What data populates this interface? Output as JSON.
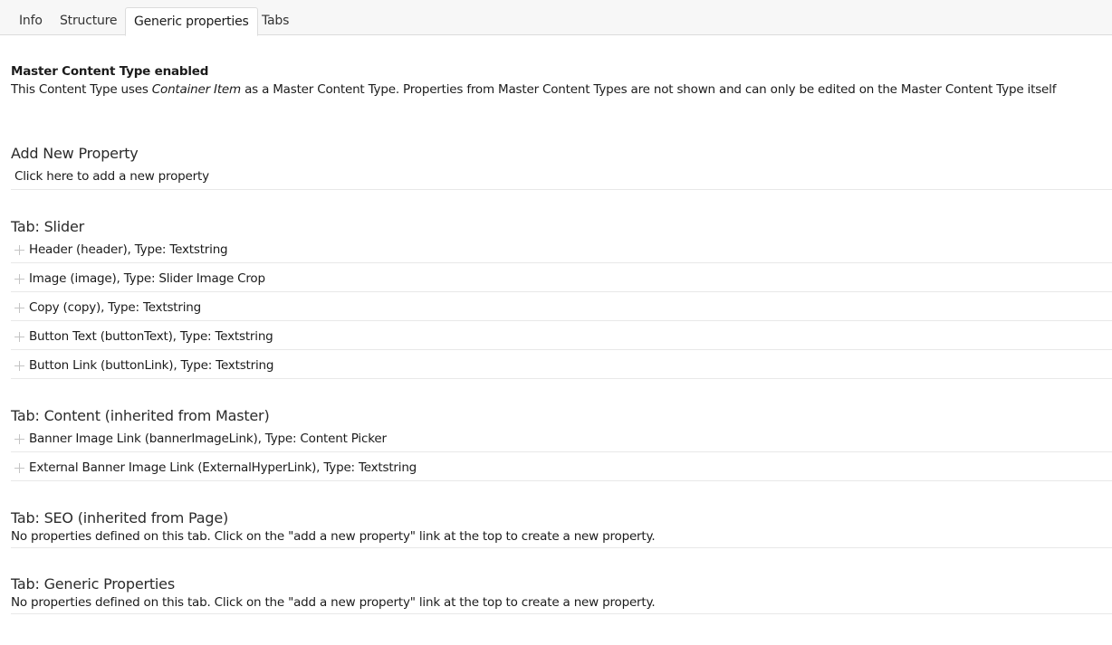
{
  "tabs": [
    {
      "label": "Info",
      "active": false
    },
    {
      "label": "Structure",
      "active": false
    },
    {
      "label": "Generic properties",
      "active": true
    },
    {
      "label": "Tabs",
      "active": false
    }
  ],
  "master": {
    "title": "Master Content Type enabled",
    "desc_prefix": "This Content Type uses ",
    "desc_emphasis": "Container Item",
    "desc_suffix": " as a Master Content Type. Properties from Master Content Types are not shown and can only be edited on the Master Content Type itself"
  },
  "add_new": {
    "title": "Add New Property",
    "link": "Click here to add a new property"
  },
  "sections": [
    {
      "title": "Tab: Slider",
      "properties": [
        "Header (header), Type: Textstring",
        "Image (image), Type: Slider Image Crop",
        "Copy (copy), Type: Textstring",
        "Button Text (buttonText), Type: Textstring",
        "Button Link (buttonLink), Type: Textstring"
      ]
    },
    {
      "title": "Tab: Content (inherited from Master)",
      "properties": [
        "Banner Image Link (bannerImageLink), Type: Content Picker",
        "External Banner Image Link (ExternalHyperLink), Type: Textstring"
      ]
    },
    {
      "title": "Tab: SEO (inherited from Page)",
      "empty_note": "No properties defined on this tab. Click on the \"add a new property\" link at the top to create a new property."
    },
    {
      "title": "Tab: Generic Properties",
      "empty_note": "No properties defined on this tab. Click on the \"add a new property\" link at the top to create a new property."
    }
  ]
}
